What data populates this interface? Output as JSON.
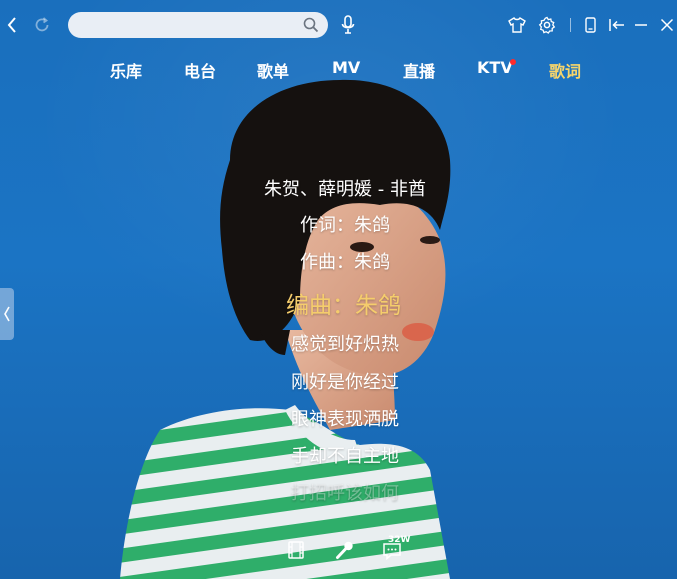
{
  "search": {
    "placeholder": "",
    "value": ""
  },
  "nav": {
    "items": [
      {
        "label": "乐库",
        "active": false
      },
      {
        "label": "电台",
        "active": false
      },
      {
        "label": "歌单",
        "active": false
      },
      {
        "label": "MV",
        "active": false
      },
      {
        "label": "直播",
        "active": false
      },
      {
        "label": "KTV",
        "active": false,
        "has_dot": true
      },
      {
        "label": "歌词",
        "active": true
      }
    ]
  },
  "lyrics": {
    "lines": [
      {
        "text": "朱贺、薛明媛 - 非酋",
        "state": "normal"
      },
      {
        "text": "作词：朱鸽",
        "state": "normal"
      },
      {
        "text": "作曲：朱鸽",
        "state": "normal"
      },
      {
        "text": "编曲：朱鸽",
        "state": "current"
      },
      {
        "text": "感觉到好炽热",
        "state": "normal"
      },
      {
        "text": "刚好是你经过",
        "state": "normal"
      },
      {
        "text": "眼神表现洒脱",
        "state": "normal"
      },
      {
        "text": "手却不自主地",
        "state": "normal"
      },
      {
        "text": "打招呼该如何",
        "state": "fade"
      }
    ]
  },
  "bottom": {
    "comment_count": "32W"
  },
  "colors": {
    "background": "#1b6fbb",
    "active_nav": "#f7d56b",
    "current_lyric": "#f5cd6c",
    "notification_dot": "#ff2a2a"
  },
  "icons": {
    "top_left": [
      "back-icon",
      "refresh-icon"
    ],
    "search": "search-icon",
    "voice": "microphone-icon",
    "top_right": [
      "skin-icon",
      "settings-icon",
      "mobile-icon",
      "mini-mode-icon",
      "minimize-icon",
      "close-icon"
    ],
    "bottom": [
      "mv-film-icon",
      "karaoke-mic-icon",
      "comment-icon"
    ]
  }
}
